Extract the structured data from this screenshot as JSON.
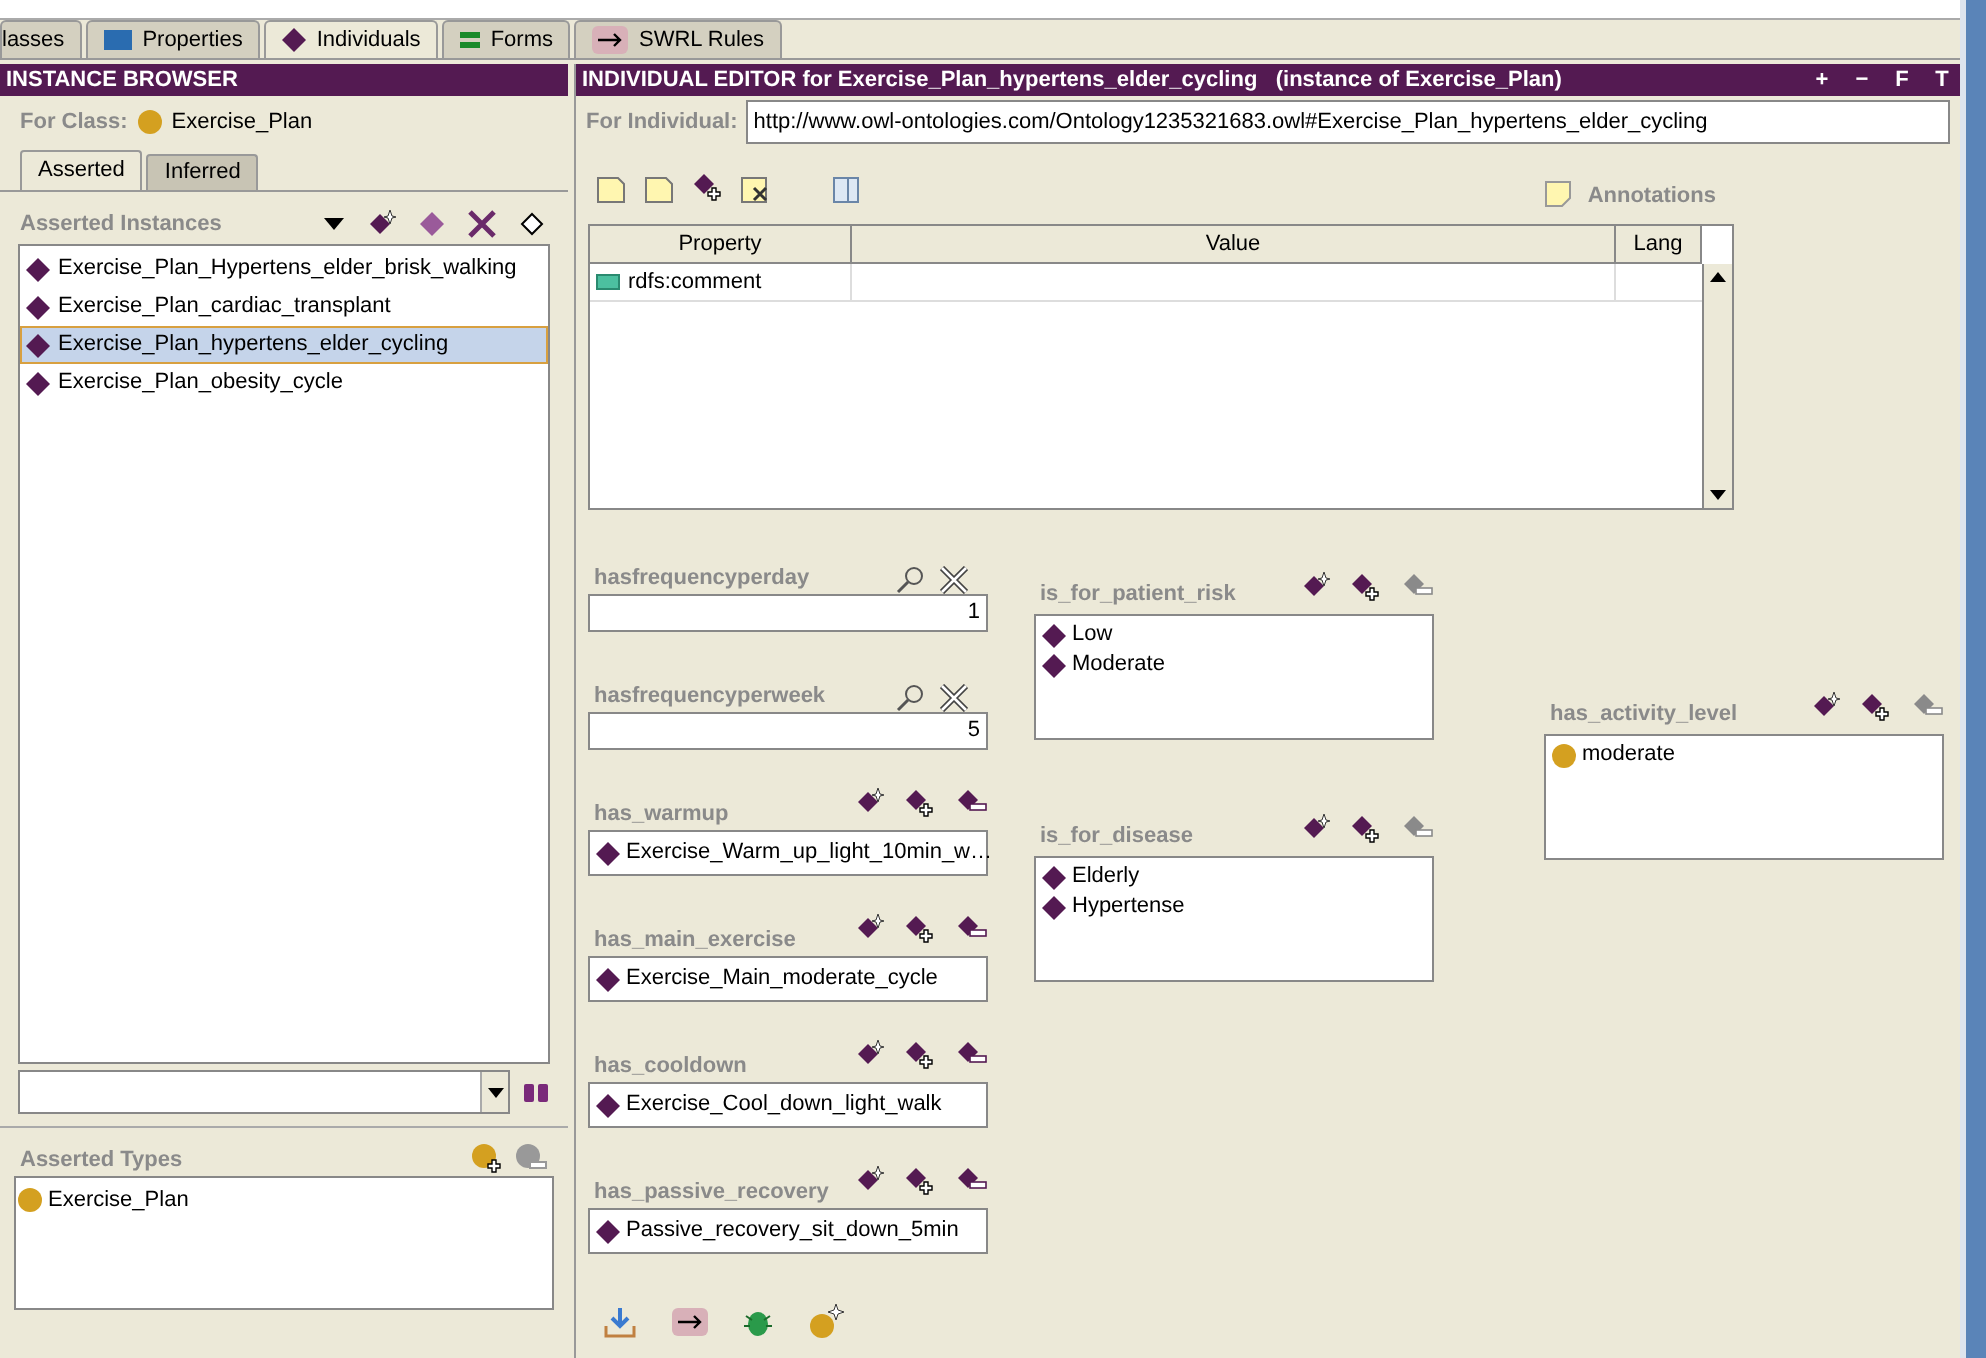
{
  "tabs": [
    {
      "label": "lasses",
      "kind": "classes",
      "selected": false
    },
    {
      "label": "Properties",
      "kind": "properties",
      "selected": false
    },
    {
      "label": "Individuals",
      "kind": "individuals",
      "selected": true
    },
    {
      "label": "Forms",
      "kind": "forms",
      "selected": false
    },
    {
      "label": "SWRL Rules",
      "kind": "rules",
      "selected": false
    }
  ],
  "instance_browser": {
    "title": "INSTANCE BROWSER",
    "for_class_label": "For Class:",
    "for_class_value": "Exercise_Plan",
    "subtabs": [
      {
        "label": "Asserted",
        "selected": true
      },
      {
        "label": "Inferred",
        "selected": false
      }
    ],
    "section_title": "Asserted Instances",
    "instances": [
      {
        "label": "Exercise_Plan_Hypertens_elder_brisk_walking",
        "selected": false
      },
      {
        "label": "Exercise_Plan_cardiac_transplant",
        "selected": false
      },
      {
        "label": "Exercise_Plan_hypertens_elder_cycling",
        "selected": true
      },
      {
        "label": "Exercise_Plan_obesity_cycle",
        "selected": false
      }
    ],
    "asserted_types": {
      "title": "Asserted Types",
      "items": [
        "Exercise_Plan"
      ]
    }
  },
  "editor": {
    "title": "INDIVIDUAL EDITOR for Exercise_Plan_hypertens_elder_cycling",
    "subtitle": "(instance of Exercise_Plan)",
    "header_buttons": [
      "+",
      "−",
      "F",
      "T"
    ],
    "for_individual_label": "For Individual:",
    "uri": "http://www.owl-ontologies.com/Ontology1235321683.owl#Exercise_Plan_hypertens_elder_cycling",
    "annotations_label": "Annotations",
    "table": {
      "columns": [
        "Property",
        "Value",
        "Lang"
      ],
      "rows": [
        {
          "property": "rdfs:comment"
        }
      ]
    },
    "columns": [
      [
        {
          "kind": "datatype",
          "label": "hasfrequencyperday",
          "value": "1"
        },
        {
          "kind": "datatype",
          "label": "hasfrequencyperweek",
          "value": "5"
        },
        {
          "kind": "single",
          "label": "has_warmup",
          "remove_enabled": true,
          "values": [
            {
              "kind": "individual",
              "label": "Exercise_Warm_up_light_10min_w…"
            }
          ]
        },
        {
          "kind": "single",
          "label": "has_main_exercise",
          "remove_enabled": true,
          "values": [
            {
              "kind": "individual",
              "label": "Exercise_Main_moderate_cycle"
            }
          ]
        },
        {
          "kind": "single",
          "label": "has_cooldown",
          "remove_enabled": true,
          "values": [
            {
              "kind": "individual",
              "label": "Exercise_Cool_down_light_walk"
            }
          ]
        },
        {
          "kind": "single",
          "label": "has_passive_recovery",
          "remove_enabled": true,
          "values": [
            {
              "kind": "individual",
              "label": "Passive_recovery_sit_down_5min"
            }
          ]
        }
      ],
      [
        {
          "kind": "list",
          "label": "is_for_patient_risk",
          "remove_enabled": false,
          "values": [
            {
              "kind": "individual",
              "label": "Low"
            },
            {
              "kind": "individual",
              "label": "Moderate"
            }
          ]
        },
        {
          "kind": "list",
          "label": "is_for_disease",
          "remove_enabled": false,
          "values": [
            {
              "kind": "individual",
              "label": "Elderly"
            },
            {
              "kind": "individual",
              "label": "Hypertense"
            }
          ]
        }
      ],
      [
        {
          "kind": "list",
          "label": "has_activity_level",
          "remove_enabled": false,
          "values": [
            {
              "kind": "class",
              "label": "moderate"
            }
          ]
        }
      ]
    ]
  }
}
